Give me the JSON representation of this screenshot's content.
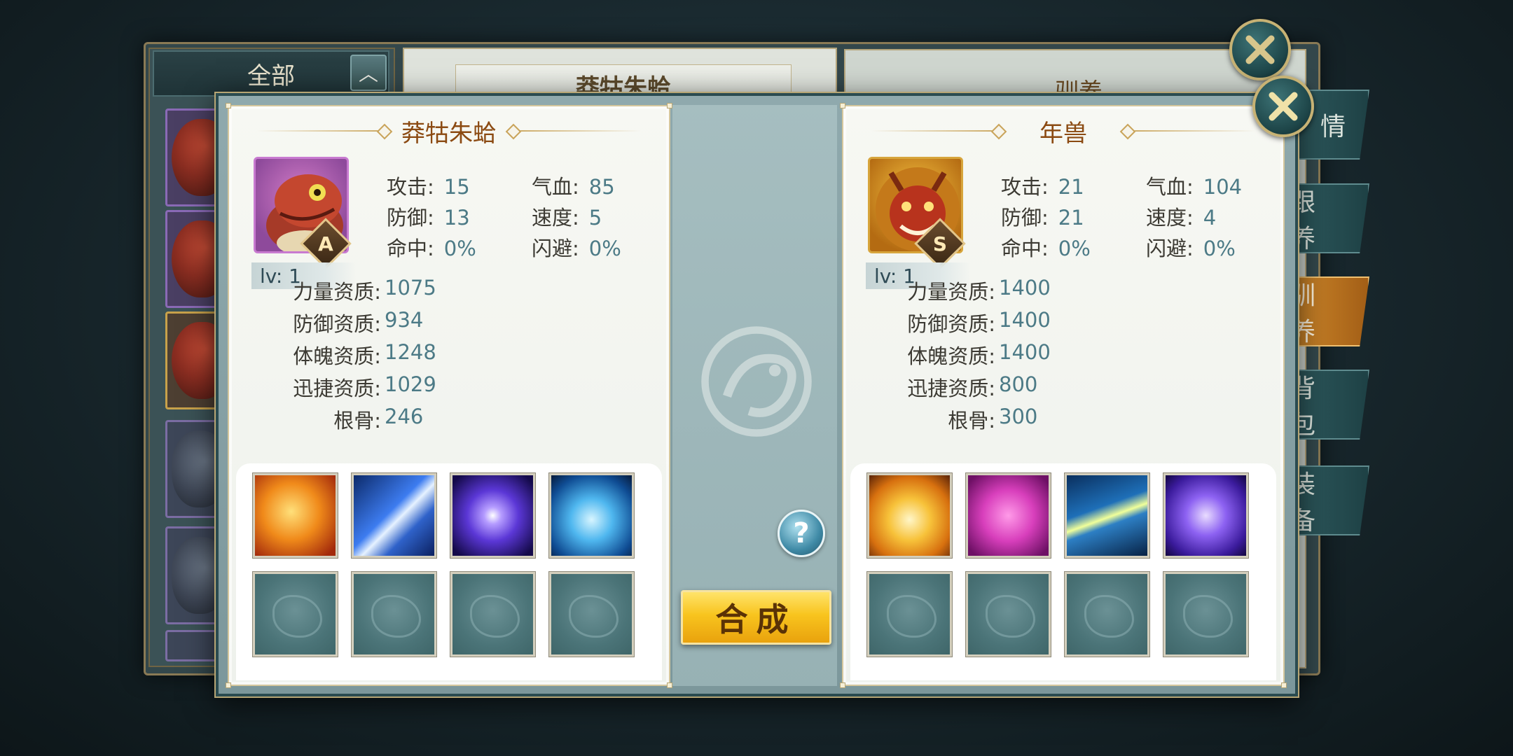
{
  "background": {
    "filter_label": "全部",
    "filter_arrow": "︿",
    "main_title": "莽牯朱蛤",
    "right_title": "驯养",
    "side_tabs": [
      "情",
      "跟 养",
      "驯 养",
      "背 包",
      "装 备"
    ]
  },
  "left_pet": {
    "name": "莽牯朱蛤",
    "grade": "A",
    "level": "lv: 1",
    "stats": {
      "attack_label": "攻击:",
      "attack": "15",
      "hp_label": "气血:",
      "hp": "85",
      "defense_label": "防御:",
      "defense": "13",
      "speed_label": "速度:",
      "speed": "5",
      "hit_label": "命中:",
      "hit": "0%",
      "dodge_label": "闪避:",
      "dodge": "0%"
    },
    "qualities": [
      {
        "label": "力量资质:",
        "value": "1075"
      },
      {
        "label": "防御资质:",
        "value": "934"
      },
      {
        "label": "体魄资质:",
        "value": "1248"
      },
      {
        "label": "迅捷资质:",
        "value": "1029"
      },
      {
        "label": "根骨:",
        "value": "246"
      }
    ],
    "skills": [
      "fire-beast-skill-icon",
      "lightning-bolt-skill-icon",
      "arcane-orb-skill-icon",
      "water-heart-skill-icon"
    ]
  },
  "right_pet": {
    "name": "年兽",
    "grade": "S",
    "level": "lv: 1",
    "stats": {
      "attack_label": "攻击:",
      "attack": "21",
      "hp_label": "气血:",
      "hp": "104",
      "defense_label": "防御:",
      "defense": "21",
      "speed_label": "速度:",
      "speed": "4",
      "hit_label": "命中:",
      "hit": "0%",
      "dodge_label": "闪避:",
      "dodge": "0%"
    },
    "qualities": [
      {
        "label": "力量资质:",
        "value": "1400"
      },
      {
        "label": "防御资质:",
        "value": "1400"
      },
      {
        "label": "体魄资质:",
        "value": "1400"
      },
      {
        "label": "迅捷资质:",
        "value": "800"
      },
      {
        "label": "根骨:",
        "value": "300"
      }
    ],
    "skills": [
      "golden-strike-skill-icon",
      "purple-shield-skill-icon",
      "crescent-slash-skill-icon",
      "violet-claw-skill-icon"
    ]
  },
  "actions": {
    "help_label": "?",
    "merge_label": "合成"
  },
  "colors": {
    "accent_gold": "#f8c41e",
    "title_brown": "#8b4a12",
    "value_teal": "#4c7a86"
  }
}
